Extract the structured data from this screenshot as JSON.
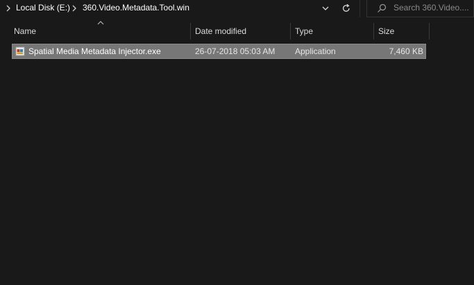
{
  "address_bar": {
    "breadcrumbs": [
      {
        "label": "Local Disk (E:)"
      },
      {
        "label": "360.Video.Metadata.Tool.win"
      }
    ]
  },
  "search": {
    "placeholder": "Search 360.Video...."
  },
  "columns": {
    "name": "Name",
    "date": "Date modified",
    "type": "Type",
    "size": "Size"
  },
  "files": [
    {
      "name": "Spatial Media Metadata Injector.exe",
      "date": "26-07-2018 05:03 AM",
      "type": "Application",
      "size": "7,460 KB",
      "icon": "exe-file-icon",
      "selected": true
    }
  ],
  "colors": {
    "background": "#191919",
    "selection": "#777777"
  }
}
